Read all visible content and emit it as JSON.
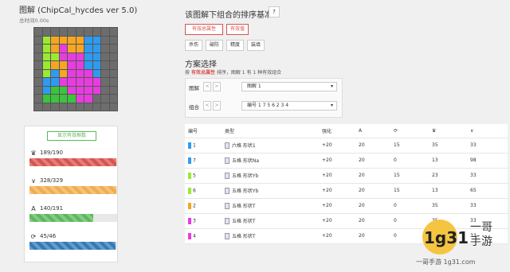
{
  "header": {
    "title": "图解 (ChipCal_hycdes ver 5.0)",
    "time": "总时间0.00s"
  },
  "grid_colors": [
    [
      "#6d6d6d",
      "#6d6d6d",
      "#6d6d6d",
      "#6d6d6d",
      "#6d6d6d",
      "#6d6d6d",
      "#6d6d6d",
      "#6d6d6d",
      "#6d6d6d",
      "#6d6d6d"
    ],
    [
      "#6d6d6d",
      "#9bea32",
      "#f5a623",
      "#f5a623",
      "#f5a623",
      "#f5a623",
      "#2e9bf0",
      "#2e9bf0",
      "#6d6d6d",
      "#6d6d6d"
    ],
    [
      "#6d6d6d",
      "#9bea32",
      "#f5a623",
      "#e83ce0",
      "#f5a623",
      "#f5a623",
      "#2e9bf0",
      "#2e9bf0",
      "#6d6d6d",
      "#6d6d6d"
    ],
    [
      "#6d6d6d",
      "#9bea32",
      "#9bea32",
      "#e83ce0",
      "#e83ce0",
      "#e83ce0",
      "#2e9bf0",
      "#2e9bf0",
      "#6d6d6d",
      "#6d6d6d"
    ],
    [
      "#6d6d6d",
      "#9bea32",
      "#f5a623",
      "#f5a623",
      "#e83ce0",
      "#e83ce0",
      "#2e9bf0",
      "#2e9bf0",
      "#6d6d6d",
      "#6d6d6d"
    ],
    [
      "#6d6d6d",
      "#9bea32",
      "#2e9bf0",
      "#f5a623",
      "#e83ce0",
      "#e83ce0",
      "#e83ce0",
      "#2e9bf0",
      "#6d6d6d",
      "#6d6d6d"
    ],
    [
      "#6d6d6d",
      "#2e9bf0",
      "#2e9bf0",
      "#e83ce0",
      "#e83ce0",
      "#e83ce0",
      "#e83ce0",
      "#e83ce0",
      "#6d6d6d",
      "#6d6d6d"
    ],
    [
      "#6d6d6d",
      "#2e9bf0",
      "#3cc43c",
      "#3cc43c",
      "#e83ce0",
      "#e83ce0",
      "#e83ce0",
      "#e83ce0",
      "#6d6d6d",
      "#6d6d6d"
    ],
    [
      "#6d6d6d",
      "#3cc43c",
      "#3cc43c",
      "#3cc43c",
      "#3cc43c",
      "#e83ce0",
      "#e83ce0",
      "#6d6d6d",
      "#6d6d6d",
      "#6d6d6d"
    ],
    [
      "#6d6d6d",
      "#6d6d6d",
      "#6d6d6d",
      "#6d6d6d",
      "#6d6d6d",
      "#6d6d6d",
      "#6d6d6d",
      "#6d6d6d",
      "#6d6d6d",
      "#6d6d6d"
    ]
  ],
  "show_btn": "显示有效框数",
  "stats": [
    {
      "icon": "♛",
      "icon_name": "crown-icon",
      "value": "189/190",
      "fraction": 0.99,
      "color": "#d9534f"
    },
    {
      "icon": "∨",
      "icon_name": "v-icon",
      "value": "328/329",
      "fraction": 0.99,
      "color": "#f0ad4e"
    },
    {
      "icon": "A",
      "icon_name": "a-icon",
      "value": "140/191",
      "fraction": 0.73,
      "color": "#5cb85c"
    },
    {
      "icon": "⟳",
      "icon_name": "refresh-icon",
      "value": "45/46",
      "fraction": 0.98,
      "color": "#337ab7"
    }
  ],
  "right": {
    "title": "该图解下组合的排序基准",
    "q": "?",
    "btn_row1": [
      "有效总属性",
      "有效值"
    ],
    "btn_row2": [
      "杀伤",
      "破防",
      "精度",
      "装填"
    ],
    "section": "方案选择",
    "note_prefix": "按",
    "note_bold": "有效总属性",
    "note_suffix": "排序，图解 1 有 1 种有效组合",
    "diagram_label": "图解",
    "diagram_sel": "图解 1",
    "combo_label": "组合",
    "combo_sel": "编号 1 7 5 6 2 3 4",
    "stepper_minus": "<",
    "stepper_plus": ">",
    "table": {
      "headers": [
        "编号",
        "类型",
        "强化",
        "A",
        "⟳",
        "♛",
        "∨"
      ],
      "rows": [
        {
          "color": "#2e9bf0",
          "no": "1",
          "type": "六格 形状1",
          "plus": "+20",
          "a": "20",
          "b": "15",
          "c": "35",
          "d": "33"
        },
        {
          "color": "#2e9bf0",
          "no": "7",
          "type": "五格 形状Na",
          "plus": "+20",
          "a": "20",
          "b": "0",
          "c": "13",
          "d": "98"
        },
        {
          "color": "#9bea32",
          "no": "5",
          "type": "五格 形状Yb",
          "plus": "+20",
          "a": "20",
          "b": "15",
          "c": "23",
          "d": "33"
        },
        {
          "color": "#9bea32",
          "no": "6",
          "type": "五格 形状Yb",
          "plus": "+20",
          "a": "20",
          "b": "15",
          "c": "13",
          "d": "65"
        },
        {
          "color": "#f5a623",
          "no": "2",
          "type": "五格 形状T",
          "plus": "+20",
          "a": "20",
          "b": "0",
          "c": "35",
          "d": "33"
        },
        {
          "color": "#e83ce0",
          "no": "3",
          "type": "五格 形状T",
          "plus": "+20",
          "a": "20",
          "b": "0",
          "c": "35",
          "d": "33"
        },
        {
          "color": "#e83ce0",
          "no": "4",
          "type": "五格 形状T",
          "plus": "+20",
          "a": "20",
          "b": "0",
          "c": "35",
          "d": "33"
        }
      ]
    }
  },
  "watermark": {
    "brand": "1g31",
    "text1": "一哥",
    "text2": "手游",
    "url": "一哥手游 1g31.com"
  }
}
